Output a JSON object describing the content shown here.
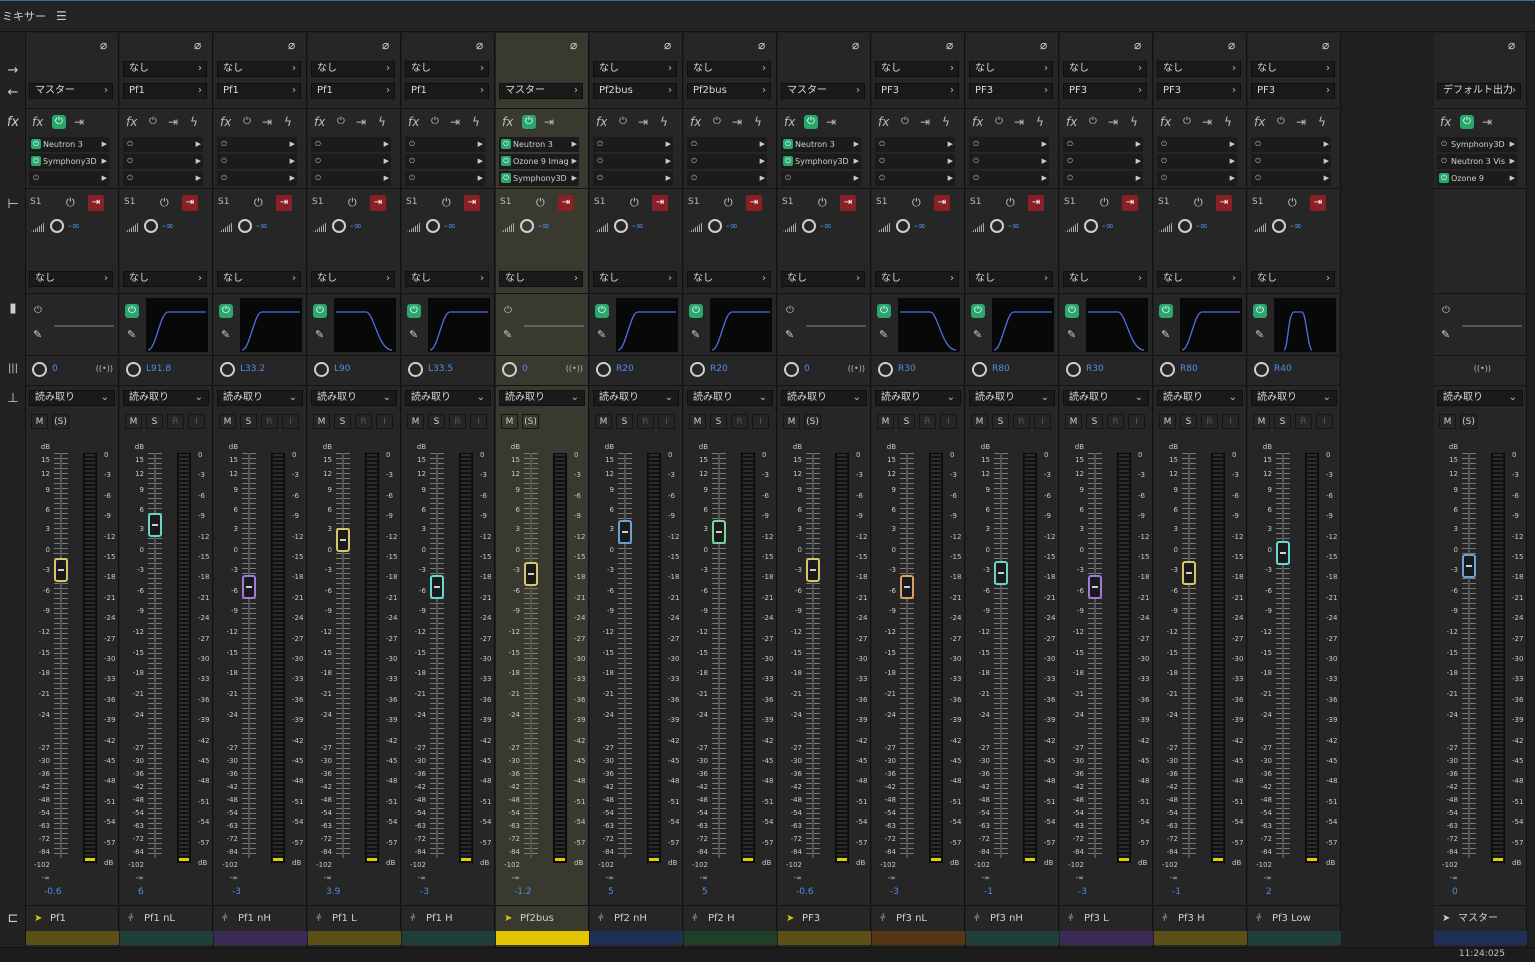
{
  "title": "ミキサー",
  "menu_icon": "hamburger-icon",
  "timecode": "11:24:025",
  "phase_symbol": "⌀",
  "none_label": "なし",
  "read_label": "読み取り",
  "s1_label": "S1",
  "inf_label": "-∞",
  "m_label": "M",
  "s_label": "S",
  "ps_label": "(S)",
  "r_label": "R",
  "i_label": "I",
  "db_label": "dB",
  "left_scale": [
    "dB",
    "15",
    "12",
    "9",
    "6",
    "3",
    "0",
    "-3",
    "-6",
    "-9",
    "-12",
    "-15",
    "-18",
    "-21",
    "-24",
    "-27",
    "-30",
    "-36",
    "-42",
    "-48",
    "-54",
    "-63",
    "-72",
    "-84",
    "-102",
    "-∞"
  ],
  "right_scale": [
    "0",
    "-3",
    "-6",
    "-9",
    "-12",
    "-15",
    "-18",
    "-21",
    "-24",
    "-27",
    "-30",
    "-33",
    "-36",
    "-39",
    "-42",
    "-45",
    "-48",
    "-51",
    "-54",
    "-57",
    "dB"
  ],
  "strips": [
    {
      "name": "Pf1",
      "input": "",
      "output": "マスター",
      "type": "bus",
      "fx": [
        "Neutron 3",
        "Symphony3D",
        ""
      ],
      "fxon": [
        true,
        true,
        false
      ],
      "fxmain": true,
      "pan": "0",
      "vol": "-0.6",
      "fader": -0.6,
      "eq": "flat",
      "color": "#5b5016",
      "cap": "#d7c56a",
      "sel": false
    },
    {
      "name": "Pf1 nL",
      "input": "なし",
      "output": "Pf1",
      "type": "track",
      "fx": [
        "",
        "",
        ""
      ],
      "fxon": [
        false,
        false,
        false
      ],
      "fxmain": false,
      "pan": "L91.8",
      "vol": "6",
      "fader": 6,
      "eq": "hp",
      "color": "#1f3f39",
      "cap": "#6ad7c6",
      "sel": false
    },
    {
      "name": "Pf1 nH",
      "input": "なし",
      "output": "Pf1",
      "type": "track",
      "fx": [
        "",
        "",
        ""
      ],
      "fxon": [
        false,
        false,
        false
      ],
      "fxmain": false,
      "pan": "L33.2",
      "vol": "-3",
      "fader": -3,
      "eq": "hp",
      "color": "#3b2a55",
      "cap": "#a27ad7",
      "sel": false
    },
    {
      "name": "Pf1 L",
      "input": "なし",
      "output": "Pf1",
      "type": "track",
      "fx": [
        "",
        "",
        ""
      ],
      "fxon": [
        false,
        false,
        false
      ],
      "fxmain": false,
      "pan": "L90",
      "vol": "3.9",
      "fader": 3.9,
      "eq": "lp",
      "color": "#5b5016",
      "cap": "#d7c56a",
      "sel": false
    },
    {
      "name": "Pf1 H",
      "input": "なし",
      "output": "Pf1",
      "type": "track",
      "fx": [
        "",
        "",
        ""
      ],
      "fxon": [
        false,
        false,
        false
      ],
      "fxmain": false,
      "pan": "L33.5",
      "vol": "-3",
      "fader": -3,
      "eq": "hp",
      "color": "#1f3f39",
      "cap": "#6ad7d7",
      "sel": false
    },
    {
      "name": "Pf2bus",
      "input": "",
      "output": "マスター",
      "type": "bus",
      "fx": [
        "Neutron 3",
        "Ozone 9 Imag",
        "Symphony3D"
      ],
      "fxon": [
        true,
        true,
        true
      ],
      "fxmain": true,
      "pan": "0",
      "vol": "-1.2",
      "fader": -1.2,
      "eq": "flat",
      "color": "#e3c400",
      "cap": "#d7c56a",
      "sel": true
    },
    {
      "name": "Pf2 nH",
      "input": "なし",
      "output": "Pf2bus",
      "type": "track",
      "fx": [
        "",
        "",
        ""
      ],
      "fxon": [
        false,
        false,
        false
      ],
      "fxmain": false,
      "pan": "R20",
      "vol": "5",
      "fader": 5,
      "eq": "hp",
      "color": "#1f2f55",
      "cap": "#6aa2d7",
      "sel": false
    },
    {
      "name": "Pf2 H",
      "input": "なし",
      "output": "Pf2bus",
      "type": "track",
      "fx": [
        "",
        "",
        ""
      ],
      "fxon": [
        false,
        false,
        false
      ],
      "fxmain": false,
      "pan": "R20",
      "vol": "5",
      "fader": 5,
      "eq": "hp",
      "color": "#1f3f26",
      "cap": "#7ad79a",
      "sel": false
    },
    {
      "name": "PF3",
      "input": "",
      "output": "マスター",
      "type": "bus",
      "fx": [
        "Neutron 3",
        "Symphony3D",
        ""
      ],
      "fxon": [
        true,
        true,
        false
      ],
      "fxmain": true,
      "pan": "0",
      "vol": "-0.6",
      "fader": -0.6,
      "eq": "flat",
      "color": "#5b5016",
      "cap": "#d7c56a",
      "sel": false
    },
    {
      "name": "Pf3 nL",
      "input": "なし",
      "output": "PF3",
      "type": "track",
      "fx": [
        "",
        "",
        ""
      ],
      "fxon": [
        false,
        false,
        false
      ],
      "fxmain": false,
      "pan": "R30",
      "vol": "-3",
      "fader": -3,
      "eq": "lp",
      "color": "#553516",
      "cap": "#d7a26a",
      "sel": false
    },
    {
      "name": "Pf3 nH",
      "input": "なし",
      "output": "PF3",
      "type": "track",
      "fx": [
        "",
        "",
        ""
      ],
      "fxon": [
        false,
        false,
        false
      ],
      "fxmain": false,
      "pan": "R80",
      "vol": "-1",
      "fader": -1,
      "eq": "hp",
      "color": "#1f3f39",
      "cap": "#6ad7c6",
      "sel": false
    },
    {
      "name": "Pf3 L",
      "input": "なし",
      "output": "PF3",
      "type": "track",
      "fx": [
        "",
        "",
        ""
      ],
      "fxon": [
        false,
        false,
        false
      ],
      "fxmain": false,
      "pan": "R30",
      "vol": "-3",
      "fader": -3,
      "eq": "lp",
      "color": "#3b2a55",
      "cap": "#a27ad7",
      "sel": false
    },
    {
      "name": "Pf3 H",
      "input": "なし",
      "output": "PF3",
      "type": "track",
      "fx": [
        "",
        "",
        ""
      ],
      "fxon": [
        false,
        false,
        false
      ],
      "fxmain": false,
      "pan": "R80",
      "vol": "-1",
      "fader": -1,
      "eq": "hp",
      "color": "#5b5016",
      "cap": "#d7c56a",
      "sel": false
    },
    {
      "name": "Pf3 Low",
      "input": "なし",
      "output": "PF3",
      "type": "track",
      "fx": [
        "",
        "",
        ""
      ],
      "fxon": [
        false,
        false,
        false
      ],
      "fxmain": false,
      "pan": "R40",
      "vol": "2",
      "fader": 2,
      "eq": "bp",
      "color": "#1f3f39",
      "cap": "#6ad7d7",
      "sel": false
    }
  ],
  "master": {
    "name": "マスター",
    "output": "デフォルト出力",
    "type": "master",
    "fx": [
      "Symphony3D",
      "Neutron 3 Vis",
      "Ozone 9"
    ],
    "fxon": [
      false,
      false,
      true
    ],
    "fxmain": true,
    "pan": "",
    "vol": "0",
    "fader": 0,
    "eq": "flat",
    "color": "#1f2f55",
    "cap": "#6aa2d7"
  }
}
